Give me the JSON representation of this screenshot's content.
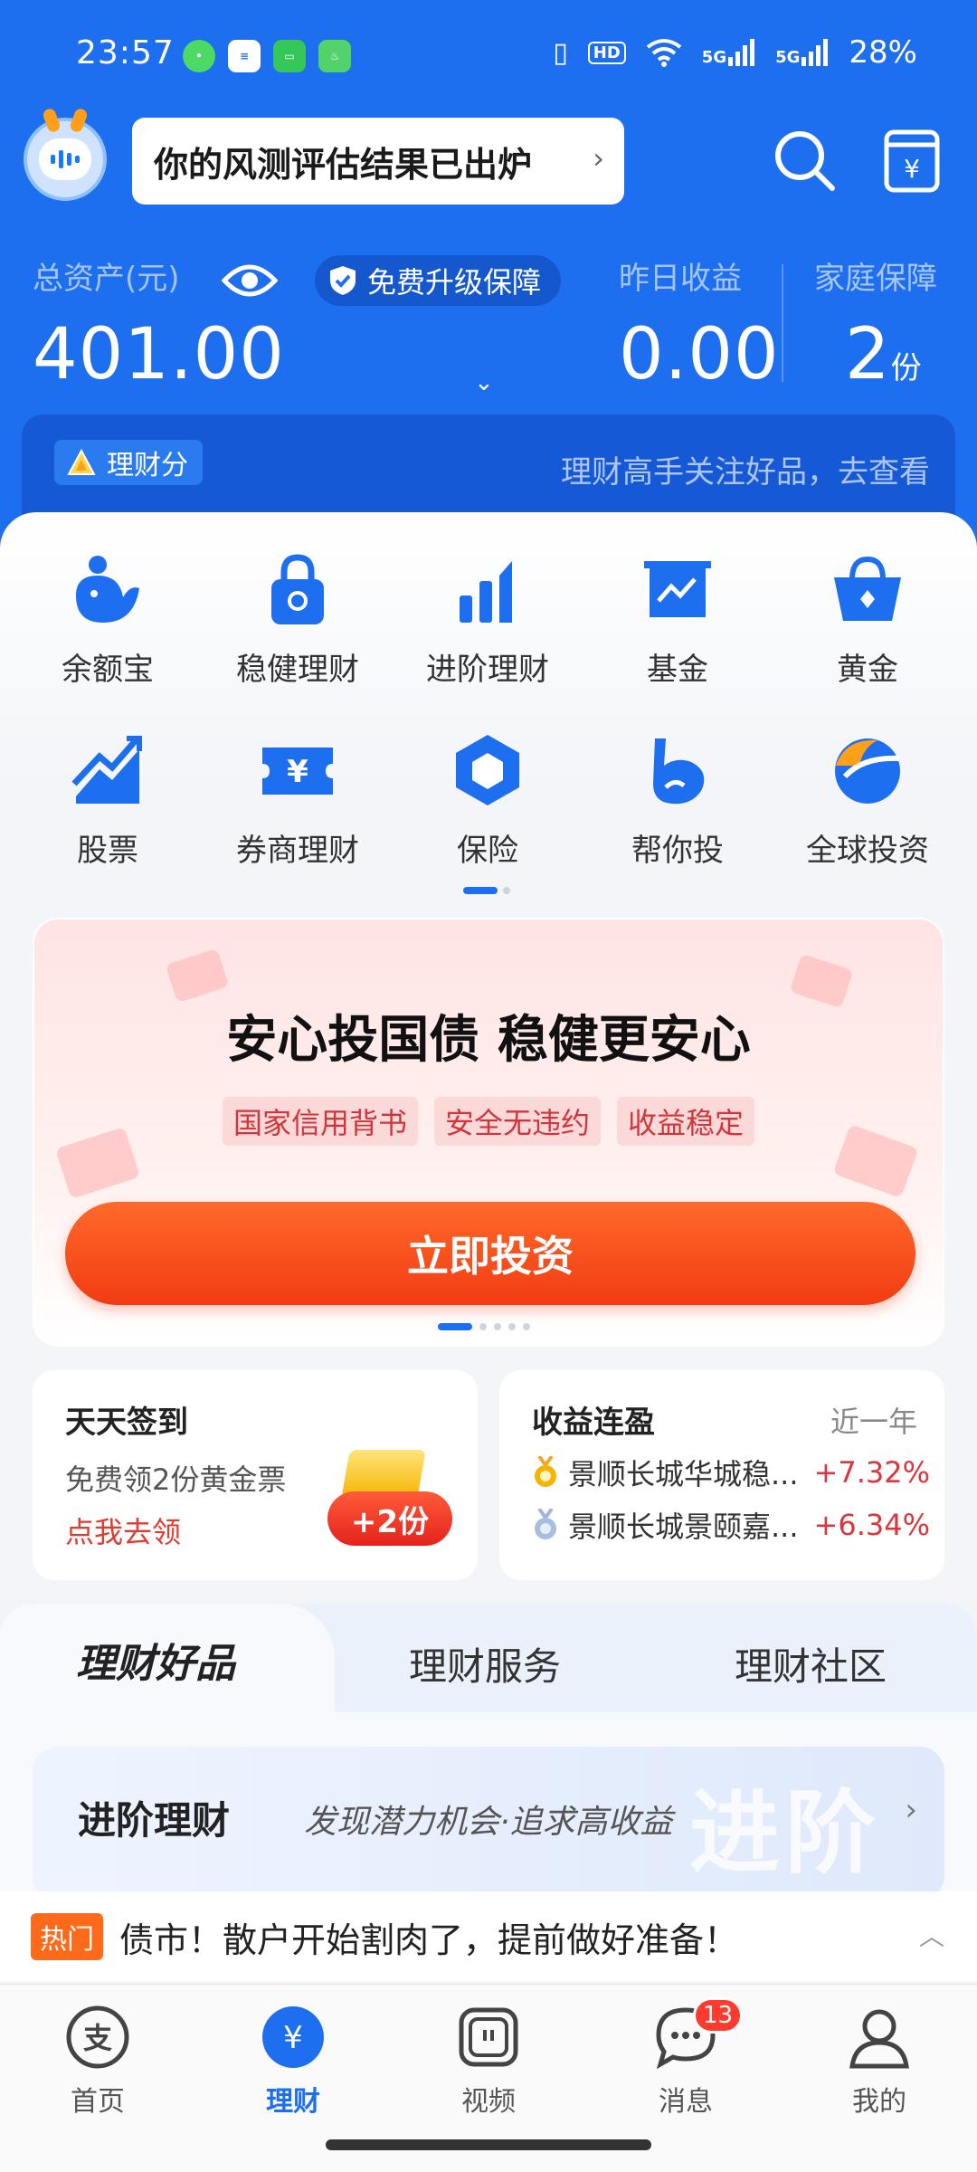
{
  "status_bar": {
    "time": "23:57",
    "battery": "28%",
    "hd_label": "HD",
    "network_1": "5G",
    "network_2": "5G"
  },
  "header": {
    "notice": "你的风测评估结果已出炉",
    "total_assets_label": "总资产(元)",
    "total_assets_value": "401.00",
    "upgrade_label": "免费升级保障",
    "yesterday_label": "昨日收益",
    "yesterday_value": "0.00",
    "family_label": "家庭保障",
    "family_value": "2",
    "family_unit": "份",
    "score_badge": "理财分",
    "score_promo": "理财高手关注好品，去查看"
  },
  "shortcuts": [
    {
      "label": "余额宝",
      "icon": "yuebao-icon"
    },
    {
      "label": "稳健理财",
      "icon": "lock-wallet-icon"
    },
    {
      "label": "进阶理财",
      "icon": "bar-growth-icon"
    },
    {
      "label": "基金",
      "icon": "fund-chart-icon"
    },
    {
      "label": "黄金",
      "icon": "gold-basket-icon"
    },
    {
      "label": "股票",
      "icon": "stock-trend-icon"
    },
    {
      "label": "券商理财",
      "icon": "ticket-yen-icon"
    },
    {
      "label": "保险",
      "icon": "insurance-shield-icon"
    },
    {
      "label": "帮你投",
      "icon": "help-invest-icon"
    },
    {
      "label": "全球投资",
      "icon": "globe-icon"
    }
  ],
  "promo": {
    "title": "安心投国债 稳健更安心",
    "tags": [
      "国家信用背书",
      "安全无违约",
      "收益稳定"
    ],
    "button": "立即投资"
  },
  "checkin_card": {
    "title": "天天签到",
    "subtitle": "免费领2份黄金票",
    "link": "点我去领",
    "badge": "+2份"
  },
  "returns_card": {
    "title": "收益连盈",
    "period": "近一年",
    "funds": [
      {
        "name": "景顺长城华城稳...",
        "rate": "+7.32%",
        "medal": "gold"
      },
      {
        "name": "景顺长城景颐嘉...",
        "rate": "+6.34%",
        "medal": "silver"
      }
    ]
  },
  "tabs": {
    "active": "理财好品",
    "tab2": "理财服务",
    "tab3": "理财社区"
  },
  "section": {
    "title": "进阶理财",
    "subtitle": "发现潜力机会·追求高收益",
    "watermark": "进阶"
  },
  "ticker": {
    "tag": "热门",
    "text": "债市！散户开始割肉了，提前做好准备！"
  },
  "bottom_nav": [
    {
      "label": "首页",
      "icon": "alipay-home-icon",
      "active": false
    },
    {
      "label": "理财",
      "icon": "wealth-yen-icon",
      "active": true
    },
    {
      "label": "视频",
      "icon": "video-icon",
      "active": false
    },
    {
      "label": "消息",
      "icon": "message-bubble-icon",
      "active": false,
      "badge": "13"
    },
    {
      "label": "我的",
      "icon": "profile-icon",
      "active": false
    }
  ],
  "colors": {
    "brand_blue": "#1e6ff0",
    "promo_red": "#f23b14",
    "rate_red": "#d9363e"
  }
}
